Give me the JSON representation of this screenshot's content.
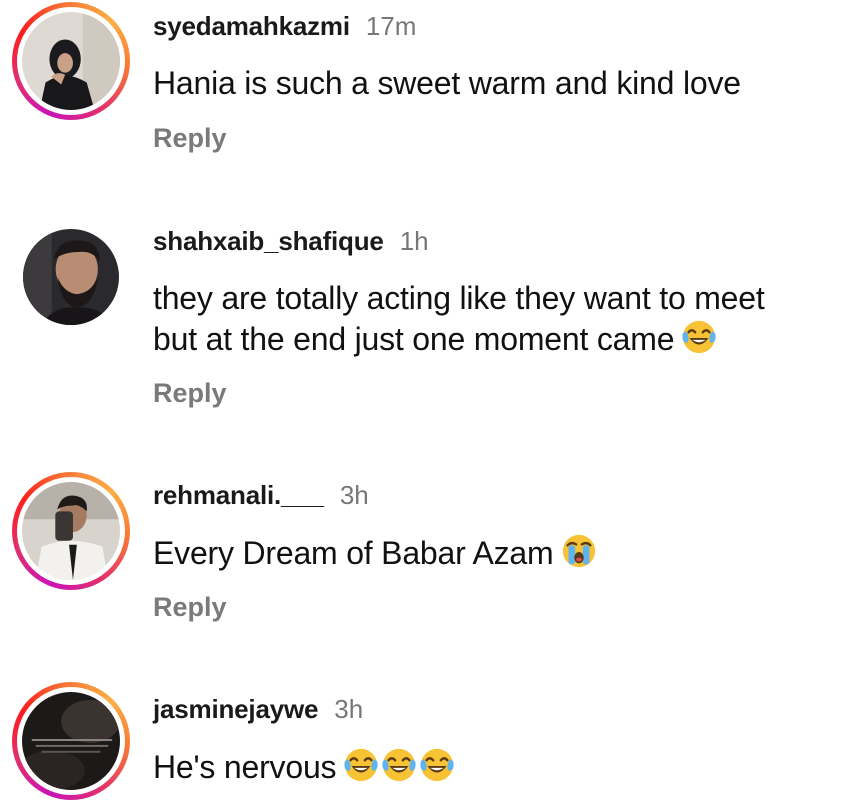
{
  "comments": [
    {
      "username": "syedamahkazmi",
      "time": "17m",
      "text": "Hania is such a sweet warm and kind love",
      "reply": "Reply",
      "story_ring": true,
      "emojis": []
    },
    {
      "username": "shahxaib_shafique",
      "time": "1h",
      "text_line1": "they are totally acting like they want to meet",
      "text_line2": "but at the end just one moment came",
      "reply": "Reply",
      "story_ring": false,
      "emojis": [
        "tears-of-joy"
      ]
    },
    {
      "username": "rehmanali.___",
      "time": "3h",
      "text": "Every Dream of Babar Azam",
      "reply": "Reply",
      "story_ring": true,
      "emojis": [
        "loudly-crying"
      ]
    },
    {
      "username": "jasminejaywe",
      "time": "3h",
      "text": "He's nervous",
      "story_ring": true,
      "emojis": [
        "tears-of-joy",
        "tears-of-joy",
        "tears-of-joy"
      ]
    }
  ],
  "colors": {
    "story_ring_start": "#c913b9",
    "story_ring_end": "#fcaf45",
    "timestamp": "#777777",
    "reply": "#7a7a7a"
  }
}
